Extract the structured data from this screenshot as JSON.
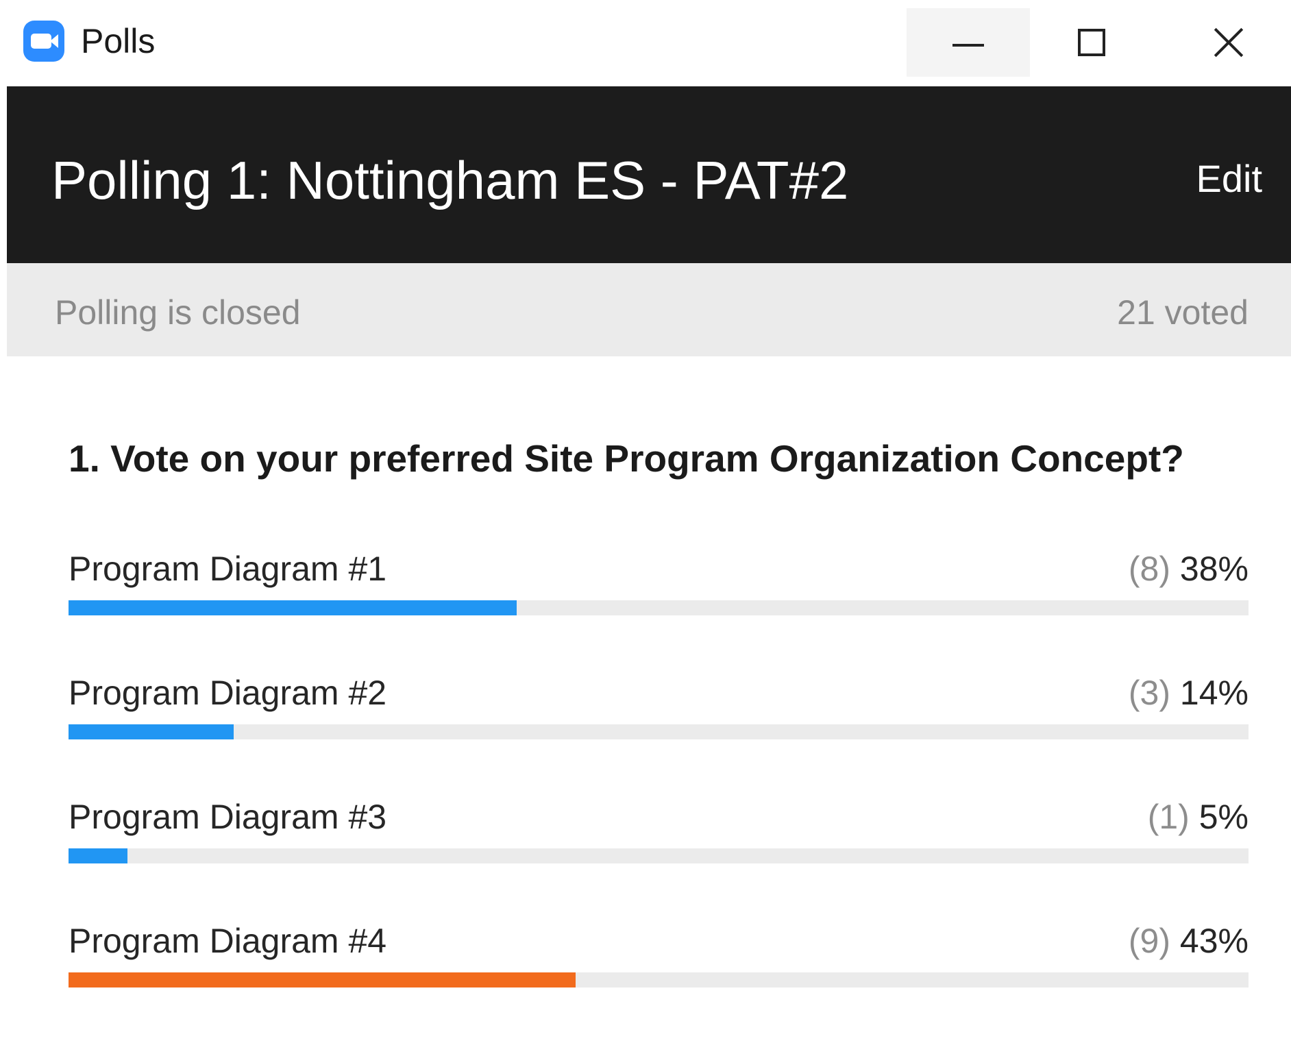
{
  "window": {
    "title": "Polls"
  },
  "header": {
    "poll_title": "Polling 1: Nottingham ES - PAT#2",
    "edit_label": "Edit"
  },
  "status": {
    "state": "Polling is closed",
    "voted": "21 voted"
  },
  "question": "1. Vote on your preferred Site Program Organization Concept?",
  "options": [
    {
      "label": "Program Diagram #1",
      "count": "(8)",
      "percent": "38%",
      "fraction": 0.38,
      "color": "#2196f3"
    },
    {
      "label": "Program Diagram #2",
      "count": "(3)",
      "percent": "14%",
      "fraction": 0.14,
      "color": "#2196f3"
    },
    {
      "label": "Program Diagram #3",
      "count": "(1)",
      "percent": "5%",
      "fraction": 0.05,
      "color": "#2196f3"
    },
    {
      "label": "Program Diagram #4",
      "count": "(9)",
      "percent": "43%",
      "fraction": 0.43,
      "color": "#f26b1d"
    }
  ],
  "colors": {
    "header_bg": "#1c1c1c",
    "status_bg": "#ebebeb",
    "bar_track": "#ebebeb",
    "accent_blue": "#2196f3",
    "winner_orange": "#f26b1d",
    "app_icon": "#2d8cff"
  },
  "icons": {
    "app": "zoom-camera-icon",
    "minimize": "minimize-icon",
    "maximize": "maximize-icon",
    "close": "close-icon"
  }
}
